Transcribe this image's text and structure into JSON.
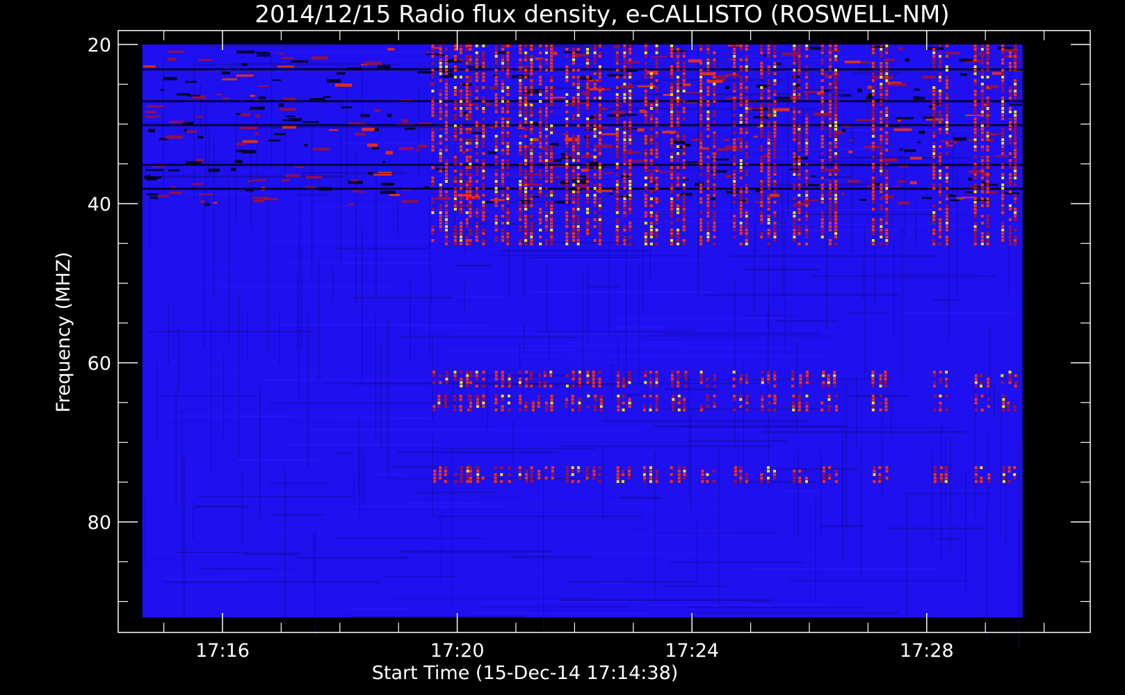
{
  "chart_data": {
    "type": "heatmap",
    "title": "2014/12/15  Radio flux density, e-CALLISTO (ROSWELL-NM)",
    "xlabel": "Start Time (15-Dec-14 17:14:38)",
    "ylabel": "Frequency (MHZ)",
    "x_ticks": [
      "17:16",
      "17:20",
      "17:24",
      "17:28"
    ],
    "y_ticks": [
      "20",
      "40",
      "60",
      "80"
    ],
    "ylim": [
      20,
      92
    ],
    "y_inverted": true,
    "colors": {
      "background": "#000000",
      "axes": "#ffffff",
      "low": "#1e10ef",
      "medium": "#a0103a",
      "high": "#ff3300",
      "peak": "#ffe000"
    },
    "time_range": [
      "17:14:38",
      "17:29:38"
    ],
    "freq_range_mhz": [
      20,
      92
    ],
    "burst_times": [
      "17:19:42",
      "17:20:04",
      "17:20:20",
      "17:20:46",
      "17:21:10",
      "17:21:30",
      "17:21:58",
      "17:22:20",
      "17:22:50",
      "17:23:18",
      "17:23:46",
      "17:24:16",
      "17:24:50",
      "17:25:18",
      "17:25:50",
      "17:26:20",
      "17:27:12",
      "17:28:14",
      "17:28:56",
      "17:29:24"
    ],
    "burst_freq_ranges_mhz": [
      [
        20,
        45
      ],
      [
        61,
        63
      ],
      [
        64,
        66
      ],
      [
        73,
        75
      ]
    ]
  }
}
